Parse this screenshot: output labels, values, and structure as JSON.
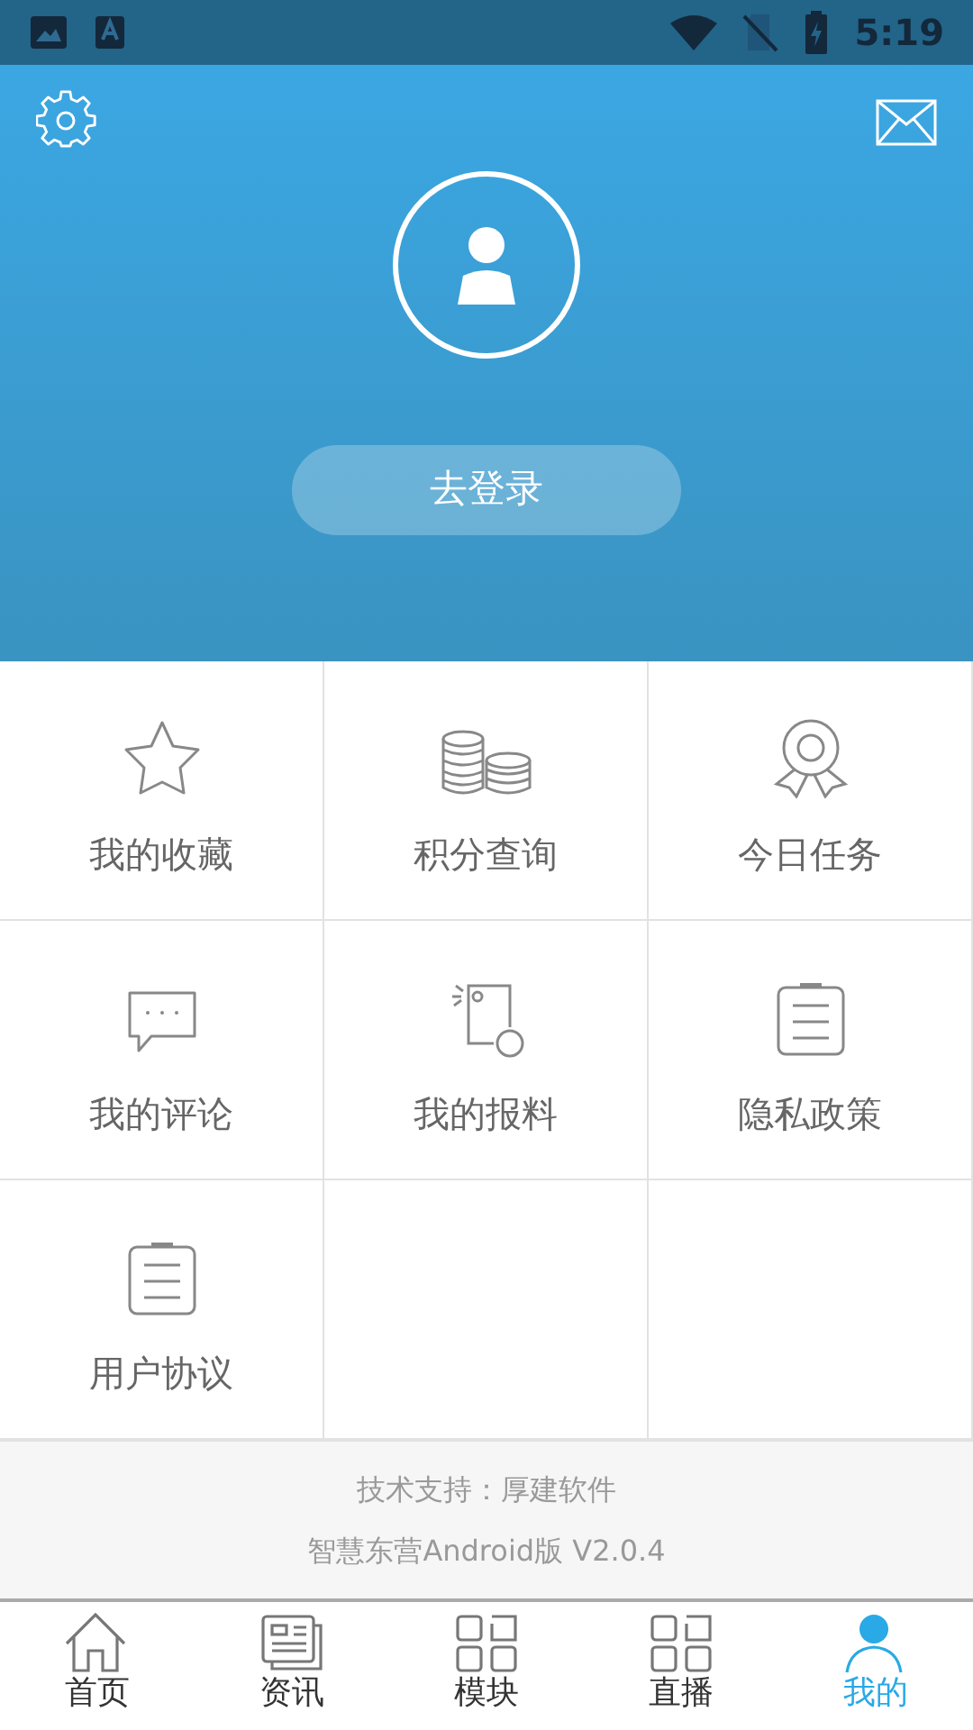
{
  "status_bar": {
    "time": "5:19"
  },
  "profile": {
    "login_button": "去登录"
  },
  "menu": [
    {
      "label": "我的收藏"
    },
    {
      "label": "积分查询"
    },
    {
      "label": "今日任务"
    },
    {
      "label": "我的评论"
    },
    {
      "label": "我的报料"
    },
    {
      "label": "隐私政策"
    },
    {
      "label": "用户协议"
    }
  ],
  "footer": {
    "support": "技术支持：厚建软件",
    "version": "智慧东营Android版 V2.0.4"
  },
  "tabs": [
    {
      "label": "首页",
      "selected": false
    },
    {
      "label": "资讯",
      "selected": false
    },
    {
      "label": "模块",
      "selected": false
    },
    {
      "label": "直播",
      "selected": false
    },
    {
      "label": "我的",
      "selected": true
    }
  ]
}
